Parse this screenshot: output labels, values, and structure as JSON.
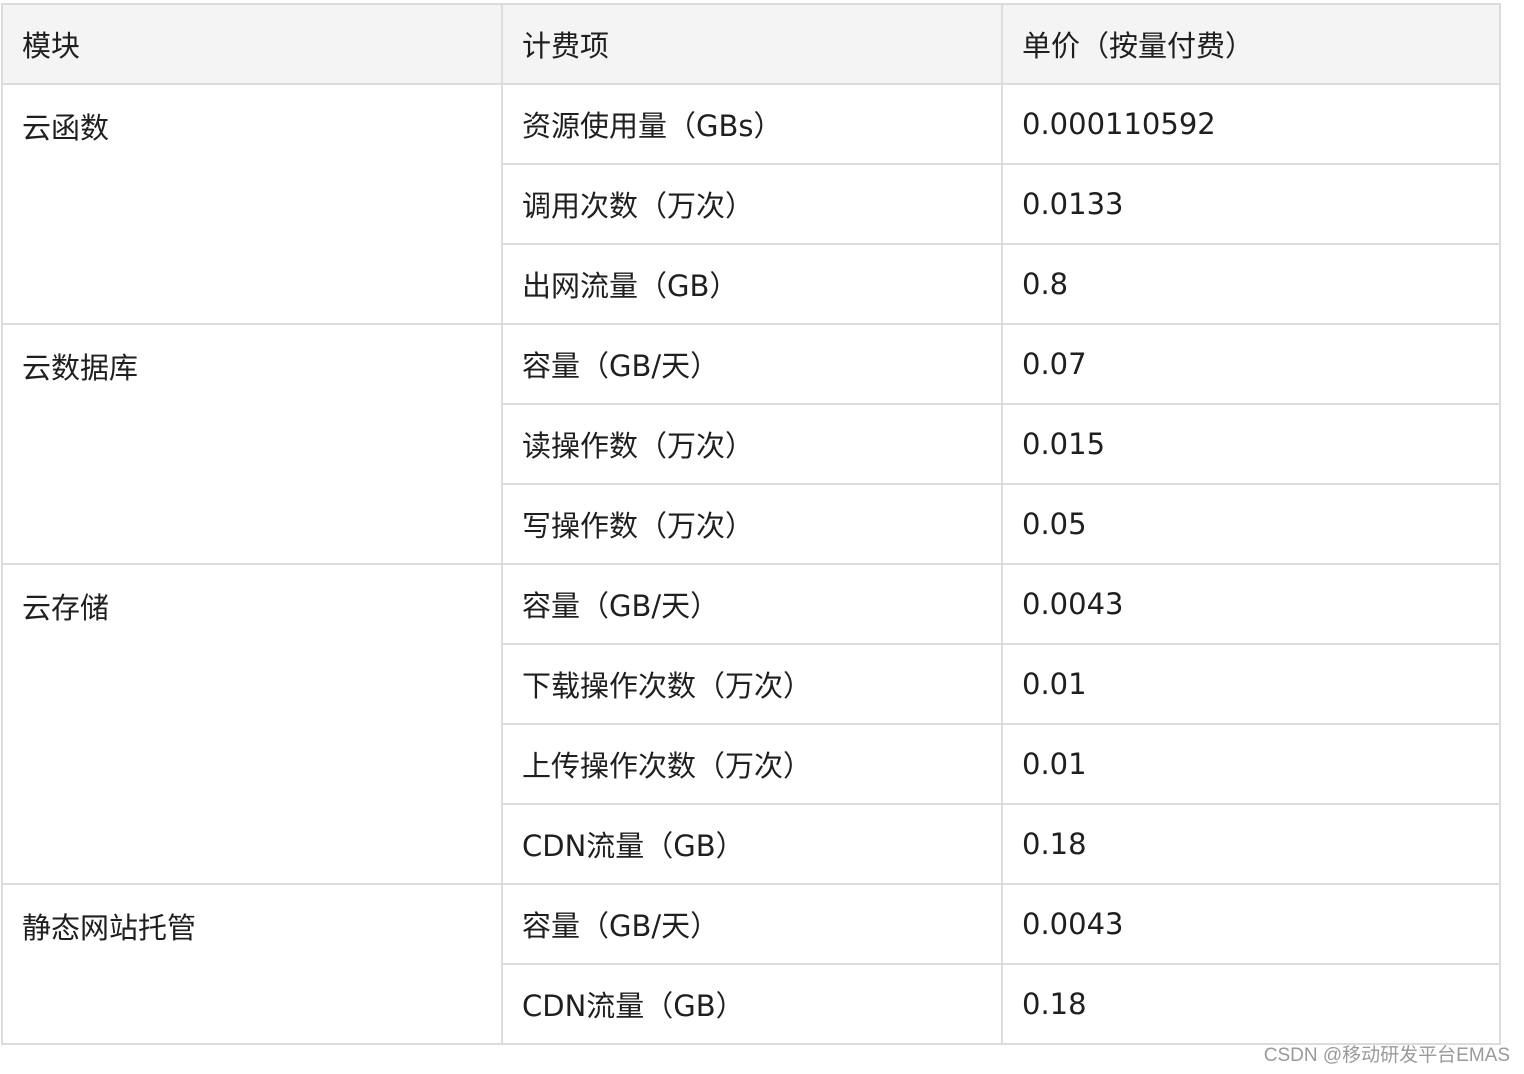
{
  "table": {
    "headers": [
      "模块",
      "计费项",
      "单价（按量付费）"
    ],
    "groups": [
      {
        "module": "云函数",
        "rows": [
          {
            "item": "资源使用量（GBs）",
            "price": "0.000110592"
          },
          {
            "item": "调用次数（万次）",
            "price": "0.0133"
          },
          {
            "item": "出网流量（GB）",
            "price": "0.8"
          }
        ]
      },
      {
        "module": "云数据库",
        "rows": [
          {
            "item": "容量（GB/天）",
            "price": "0.07"
          },
          {
            "item": "读操作数（万次）",
            "price": "0.015"
          },
          {
            "item": "写操作数（万次）",
            "price": "0.05"
          }
        ]
      },
      {
        "module": "云存储",
        "rows": [
          {
            "item": "容量（GB/天）",
            "price": "0.0043"
          },
          {
            "item": "下载操作次数（万次）",
            "price": "0.01"
          },
          {
            "item": "上传操作次数（万次）",
            "price": "0.01"
          },
          {
            "item": "CDN流量（GB）",
            "price": "0.18"
          }
        ]
      },
      {
        "module": "静态网站托管",
        "rows": [
          {
            "item": "容量（GB/天）",
            "price": "0.0043"
          },
          {
            "item": "CDN流量（GB）",
            "price": "0.18"
          }
        ]
      }
    ]
  },
  "watermark": "CSDN @移动研发平台EMAS"
}
